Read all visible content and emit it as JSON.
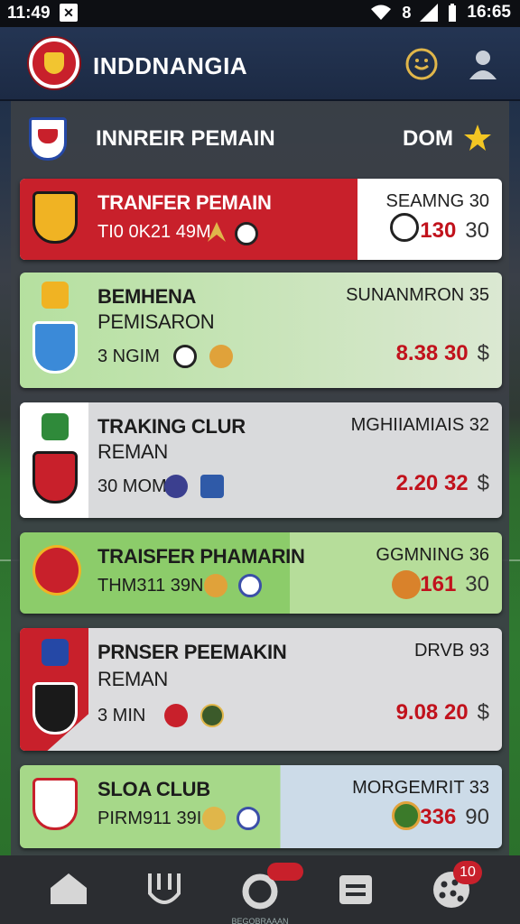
{
  "status": {
    "time": "11:49",
    "clock": "16:65",
    "signal_text": "8"
  },
  "app": {
    "title": "INDDNANGIA"
  },
  "section": {
    "title": "INNREIR PEMAIN",
    "right_label": "DOM"
  },
  "cards": [
    {
      "title": "TRANFER PEMAIN",
      "sub": "TI0 0K21 49M",
      "right_title": "SEAMNG 30",
      "value": "130",
      "value_suffix": "30",
      "theme": "red"
    },
    {
      "title": "BEMHENA",
      "title2": "PEMISARON",
      "sub": "3 NGIM",
      "right_title": "SUNANMRON 35",
      "value": "8.38 30",
      "value_suffix": "$",
      "theme": "green"
    },
    {
      "title": "TRAKING CLUR",
      "title2": "REMAN",
      "sub": "30 MOM",
      "right_title": "MGHIIAMIAIS 32",
      "value": "2.20 32",
      "value_suffix": "$",
      "theme": "white"
    },
    {
      "title": "TRAISFER PHAMARIN",
      "sub": "THM311 39N",
      "right_title": "GGMNING 36",
      "value": "161",
      "value_suffix": "30",
      "theme": "green2"
    },
    {
      "title": "PRNSER PEEMAKIN",
      "title2": "REMAN",
      "sub": "3 MIN",
      "right_title": "DRVB 93",
      "value": "9.08 20",
      "value_suffix": "$",
      "theme": "white2"
    },
    {
      "title": "SLOA CLUB",
      "sub": "PIRM911 39I",
      "right_title": "MORGEMRIT 33",
      "value": "336",
      "value_suffix": "90",
      "theme": "green3"
    }
  ],
  "nav": {
    "items": [
      {
        "icon": "home-icon"
      },
      {
        "icon": "glove-icon"
      },
      {
        "icon": "ball-icon",
        "label": "BEGOBRAAAN"
      },
      {
        "icon": "list-icon"
      },
      {
        "icon": "dots-icon",
        "badge": "10"
      }
    ]
  },
  "colors": {
    "accent": "#c8202b",
    "topbar": "#243553",
    "green": "#a8d890"
  }
}
